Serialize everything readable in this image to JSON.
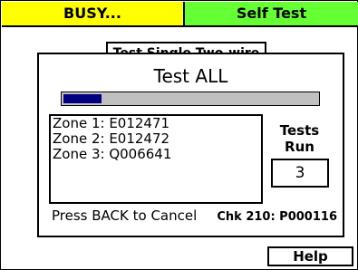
{
  "status_bar": {
    "busy_label": "BUSY...",
    "busy_color": "#ffff00",
    "mode_label": "Self Test",
    "mode_color": "#66ff33"
  },
  "background_button": {
    "label": "Test Single Two-wire"
  },
  "dialog": {
    "title": "Test ALL",
    "progress_fraction": 0.15,
    "progress_color": "#000080",
    "zones": [
      {
        "label": "Zone 1: E012471"
      },
      {
        "label": "Zone 2: E012472"
      },
      {
        "label": "Zone 3: Q006641"
      }
    ],
    "tests_run_label_line1": "Tests",
    "tests_run_label_line2": "Run",
    "tests_run_count": "3",
    "cancel_hint": "Press BACK to Cancel",
    "check_code": "Chk 210: P000116"
  },
  "help_button": {
    "label": "Help"
  }
}
